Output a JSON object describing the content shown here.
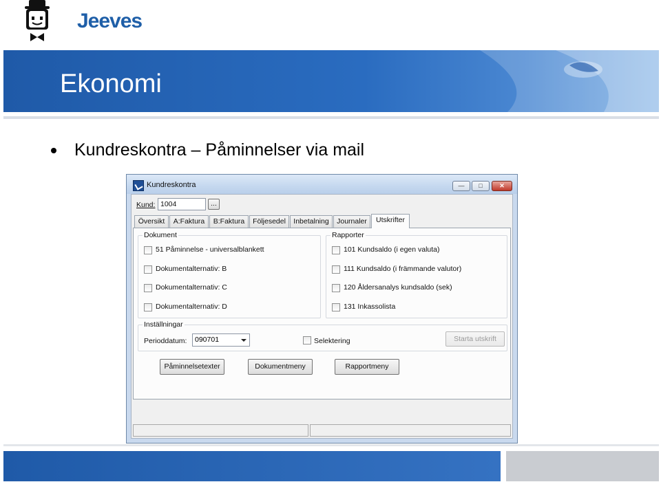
{
  "slide": {
    "logo_text": "Jeeves",
    "banner_title": "Ekonomi",
    "bullet": "Kundreskontra – Påminnelser via mail",
    "colors": {
      "brand_blue": "#1f5aa8",
      "footer_grey": "#c9ccd1"
    }
  },
  "window": {
    "title": "Kundreskontra",
    "controls": {
      "minimize": "—",
      "maximize": "□",
      "close": "✕"
    },
    "customer_label": "Kund:",
    "customer_value": "1004",
    "lookup_button": "...",
    "tabs": [
      {
        "label": "Översikt"
      },
      {
        "label": "A:Faktura"
      },
      {
        "label": "B:Faktura"
      },
      {
        "label": "Följesedel"
      },
      {
        "label": "Inbetalning"
      },
      {
        "label": "Journaler"
      },
      {
        "label": "Utskrifter",
        "active": true
      }
    ],
    "dokument": {
      "title": "Dokument",
      "items": [
        {
          "label": "51  Påminnelse - universalblankett",
          "checked": false
        },
        {
          "label": "Dokumentalternativ: B",
          "checked": false
        },
        {
          "label": "Dokumentalternativ: C",
          "checked": false
        },
        {
          "label": "Dokumentalternativ: D",
          "checked": false
        }
      ]
    },
    "rapporter": {
      "title": "Rapporter",
      "items": [
        {
          "label": "101  Kundsaldo (i egen valuta)",
          "checked": false
        },
        {
          "label": "111  Kundsaldo (i främmande valutor)",
          "checked": false
        },
        {
          "label": "120  Åldersanalys kundsaldo (sek)",
          "checked": false
        },
        {
          "label": "131  Inkassolista",
          "checked": false
        }
      ]
    },
    "installningar": {
      "title": "Inställningar",
      "period_label": "Perioddatum:",
      "period_value": "090701",
      "selektering_label": "Selektering",
      "start_button": "Starta utskrift"
    },
    "buttons": {
      "paminnelsetexter": "Påminnelsetexter",
      "dokumentmeny": "Dokumentmeny",
      "rapportmeny": "Rapportmeny"
    }
  }
}
